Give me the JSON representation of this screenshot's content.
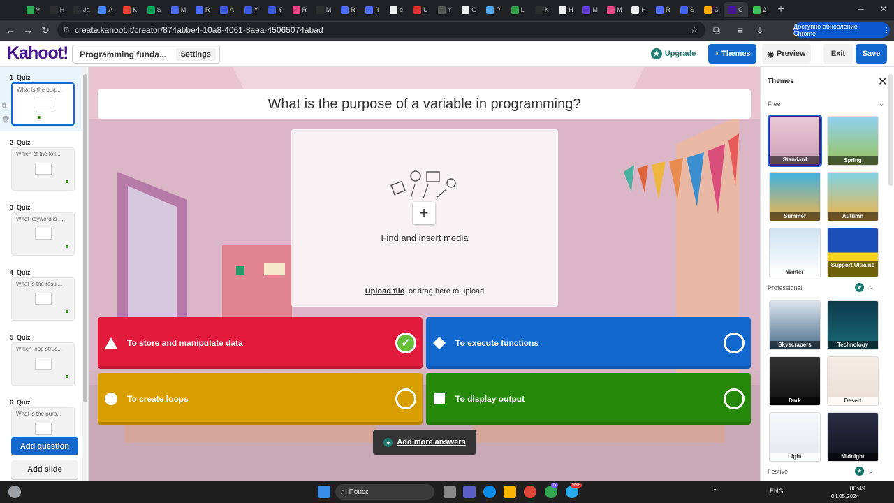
{
  "browser": {
    "tabs": [
      {
        "label": "y",
        "color": "#34a853"
      },
      {
        "label": "H",
        "color": "#2d2d2d"
      },
      {
        "label": "Ja",
        "color": "#2d2d2d"
      },
      {
        "label": "A",
        "color": "#4285f4"
      },
      {
        "label": "K",
        "color": "#ea4335"
      },
      {
        "label": "S",
        "color": "#0f9d58"
      },
      {
        "label": "M",
        "color": "#4a6ee0"
      },
      {
        "label": "R",
        "color": "#4c6ef5"
      },
      {
        "label": "A",
        "color": "#3b5bdb"
      },
      {
        "label": "Y",
        "color": "#3b5bdb"
      },
      {
        "label": "Y",
        "color": "#3b5bdb"
      },
      {
        "label": "R",
        "color": "#e64980"
      },
      {
        "label": "M",
        "color": "#2d2d2d"
      },
      {
        "label": "R",
        "color": "#4c6ef5"
      },
      {
        "label": "[I",
        "color": "#4c6ef5"
      },
      {
        "label": "e",
        "color": "#eeeeee"
      },
      {
        "label": "U",
        "color": "#e03131"
      },
      {
        "label": "Y",
        "color": "#555555"
      },
      {
        "label": "G",
        "color": "#eeeeee"
      },
      {
        "label": "P",
        "color": "#4dabf7"
      },
      {
        "label": "L",
        "color": "#2f9e44"
      },
      {
        "label": "K",
        "color": "#2d2d2d"
      },
      {
        "label": "H",
        "color": "#eeeeee"
      },
      {
        "label": "M",
        "color": "#5f3dc4"
      },
      {
        "label": "M",
        "color": "#e64980"
      },
      {
        "label": "H",
        "color": "#eeeeee"
      },
      {
        "label": "R",
        "color": "#4c6ef5"
      },
      {
        "label": "S",
        "color": "#4263eb"
      },
      {
        "label": "C",
        "color": "#fab005"
      },
      {
        "label": "C",
        "color": "#46178f"
      },
      {
        "label": "2",
        "color": "#40c057"
      }
    ],
    "new_tab": "+",
    "url": "create.kahoot.it/creator/874abbe4-10a8-4061-8aea-45065074abad",
    "update_label": "Доступно обновление Chrome"
  },
  "header": {
    "logo": "Kahoot!",
    "quiz_title": "Programming funda...",
    "settings_label": "Settings",
    "upgrade_label": "Upgrade",
    "themes_label": "Themes",
    "preview_label": "Preview",
    "exit_label": "Exit",
    "save_label": "Save"
  },
  "sidebar": {
    "slides": [
      {
        "num": "1",
        "type": "Quiz",
        "question": "What is the purp..."
      },
      {
        "num": "2",
        "type": "Quiz",
        "question": "Which of the foll..."
      },
      {
        "num": "3",
        "type": "Quiz",
        "question": "What keyword is ..."
      },
      {
        "num": "4",
        "type": "Quiz",
        "question": "What is the resul..."
      },
      {
        "num": "5",
        "type": "Quiz",
        "question": "Which loop struc..."
      },
      {
        "num": "6",
        "type": "Quiz",
        "question": "What is the purp..."
      }
    ],
    "add_question_label": "Add question",
    "add_slide_label": "Add slide"
  },
  "editor": {
    "question": "What is the purpose of a variable in programming?",
    "media_label": "Find and insert media",
    "upload_link": "Upload file",
    "upload_text": "or drag here to upload",
    "answers": [
      {
        "text": "To store and manipulate data",
        "color": "#e21b3c",
        "shape": "triangle",
        "correct": true
      },
      {
        "text": "To execute functions",
        "color": "#1368ce",
        "shape": "diamond",
        "correct": false
      },
      {
        "text": "To create loops",
        "color": "#d89e00",
        "shape": "circle",
        "correct": false
      },
      {
        "text": "To display output",
        "color": "#26890c",
        "shape": "square",
        "correct": false
      }
    ],
    "add_more_label": "Add more answers"
  },
  "themes_panel": {
    "title": "Themes",
    "sections": [
      {
        "label": "Free",
        "items": [
          "Standard",
          "Spring",
          "Summer",
          "Autumn",
          "Winter",
          "Support Ukraine"
        ]
      },
      {
        "label": "Professional",
        "items": [
          "Skyscrapers",
          "Technology",
          "Dark",
          "Desert",
          "Light",
          "Midnight"
        ]
      },
      {
        "label": "Festive",
        "items": []
      }
    ]
  },
  "taskbar": {
    "search_placeholder": "Поиск",
    "lang": "ENG",
    "time": "00:49",
    "date": "04.05.2024",
    "badge_count_1": "5",
    "badge_count_2": "99+"
  }
}
